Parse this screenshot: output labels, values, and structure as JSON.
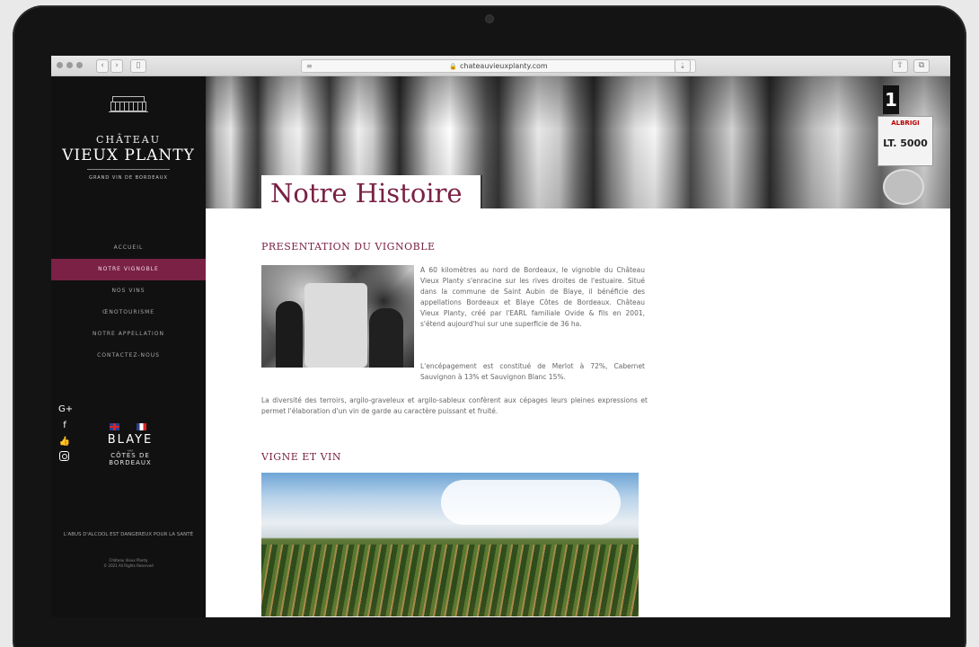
{
  "browser": {
    "url": "chateauvieuxplanty.com",
    "back_icon": "chevron-left-icon",
    "forward_icon": "chevron-right-icon"
  },
  "sidebar": {
    "logo_small": "CHÂTEAU",
    "logo_big": "VIEUX PLANTY",
    "logo_tagline": "GRAND VIN DE BORDEAUX",
    "nav": [
      {
        "label": "ACCUEIL",
        "active": false
      },
      {
        "label": "NOTRE VIGNOBLE",
        "active": true
      },
      {
        "label": "NOS VINS",
        "active": false
      },
      {
        "label": "ŒNOTOURISME",
        "active": false
      },
      {
        "label": "NOTRE APPELLATION",
        "active": false
      },
      {
        "label": "CONTACTEZ-NOUS",
        "active": false
      }
    ],
    "social": {
      "google": "G+",
      "facebook": "f",
      "like": "👍"
    },
    "blaye_big": "BLAYE",
    "blaye_line1": "CÔTES DE",
    "blaye_line2": "BORDEAUX",
    "warning": "L'ABUS D'ALCOOL EST DANGEREUX POUR LA SANTÉ",
    "copyright_line1": "Château Vieux Planty",
    "copyright_line2": "© 2021 All Rights Reserved"
  },
  "hero": {
    "title": "Notre Histoire",
    "tank_brand": "ALBRIGI",
    "tank_number": "1",
    "tank_capacity": "LT. 5000"
  },
  "content": {
    "section1_title": "PRESENTATION DU VIGNOBLE",
    "paragraph1": "A 60 kilomètres au nord de Bordeaux, le vignoble du Château Vieux Planty s'enracine sur les rives droites de l'estuaire. Situé dans la commune de Saint Aubin de Blaye, il bénéficie des appellations Bordeaux et Blaye Côtes de Bordeaux. Château Vieux Planty, créé par l'EARL familiale Ovide & fils en 2001, s'étend aujourd'hui sur une superficie de 36 ha.",
    "paragraph2": "L'encépagement est constitué de Merlot à 72%, Cabernet Sauvignon à 13% et Sauvignon Blanc 15%.",
    "paragraph3": "La diversité des terroirs, argilo-graveleux et argilo-sableux confèrent aux cépages leurs pleines expressions et permet l'élaboration d'un vin de garde au caractère puissant et fruité.",
    "section2_title": "VIGNE ET VIN"
  }
}
